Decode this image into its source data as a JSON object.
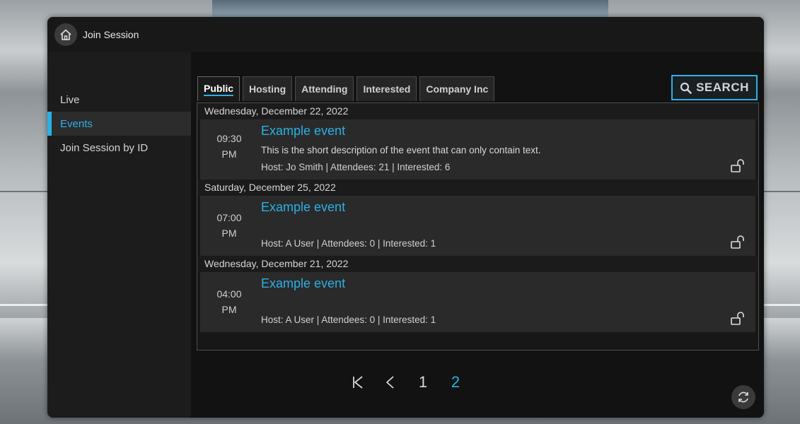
{
  "window": {
    "title": "Join Session"
  },
  "sidebar": {
    "items": [
      {
        "label": "Live"
      },
      {
        "label": "Events"
      },
      {
        "label": "Join Session by ID"
      }
    ]
  },
  "tabs": [
    {
      "label": "Public"
    },
    {
      "label": "Hosting"
    },
    {
      "label": "Attending"
    },
    {
      "label": "Interested"
    },
    {
      "label": "Company Inc"
    }
  ],
  "search": {
    "label": "SEARCH"
  },
  "events": [
    {
      "date": "Wednesday, December 22, 2022",
      "time": "09:30",
      "period": "PM",
      "title": "Example event",
      "description": "This is the short description of the event that can only contain text.",
      "host": "Host: Jo Smith | Attendees: 21 | Interested: 6"
    },
    {
      "date": "Saturday, December 25, 2022",
      "time": "07:00",
      "period": "PM",
      "title": "Example event",
      "description": "",
      "host": "Host: A User | Attendees: 0 | Interested: 1"
    },
    {
      "date": "Wednesday, December 21, 2022",
      "time": "04:00",
      "period": "PM",
      "title": "Example event",
      "description": "",
      "host": "Host: A User | Attendees: 0 | Interested: 1"
    }
  ],
  "pagination": {
    "first": "⏮",
    "prev": "‹",
    "pages": [
      "1",
      "2"
    ],
    "current": "2"
  },
  "colors": {
    "accent": "#2bb0e6",
    "panel": "#1f1f1f",
    "row": "#2a2a2a"
  },
  "icons": {
    "home": "home-icon",
    "search": "search-icon",
    "lock": "unlocked-padlock-icon",
    "first": "first-page-icon",
    "prev": "previous-page-icon",
    "refresh": "refresh-icon"
  }
}
